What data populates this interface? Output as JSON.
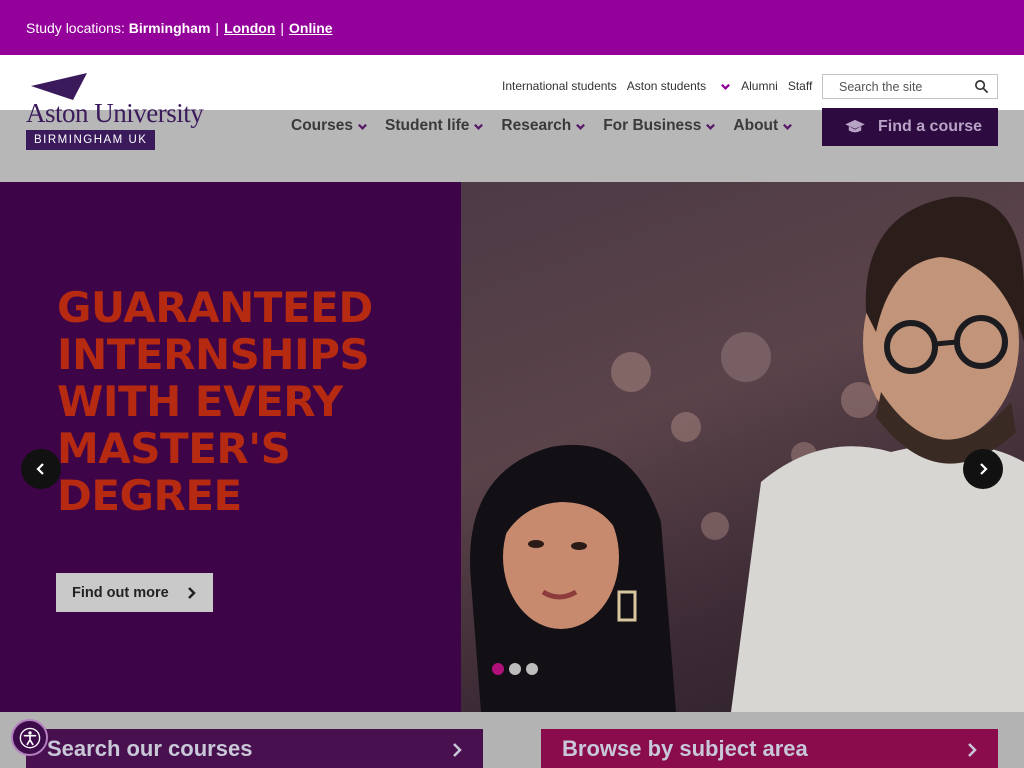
{
  "study_locations": {
    "label": "Study locations:",
    "current": "Birmingham",
    "links": [
      "London",
      "Online"
    ]
  },
  "logo": {
    "name": "Aston University",
    "location": "BIRMINGHAM UK"
  },
  "utility_nav": [
    "International students",
    "Aston students",
    "Alumni",
    "Staff"
  ],
  "search": {
    "placeholder": "Search the site"
  },
  "main_nav": [
    "Courses",
    "Student life",
    "Research",
    "For Business",
    "About"
  ],
  "find_course_label": "Find a course",
  "hero": {
    "headline": "GUARANTEED INTERNSHIPS WITH EVERY MASTER'S DEGREE",
    "cta": "Find out more",
    "slides_total": 3,
    "active_slide": 1
  },
  "cards": [
    "Search our courses",
    "Browse by subject area"
  ],
  "colors": {
    "brand_purple": "#94009a",
    "dark_purple": "#2d0a3f",
    "headline_red": "#b52a10",
    "pink": "#8a0c4d"
  }
}
